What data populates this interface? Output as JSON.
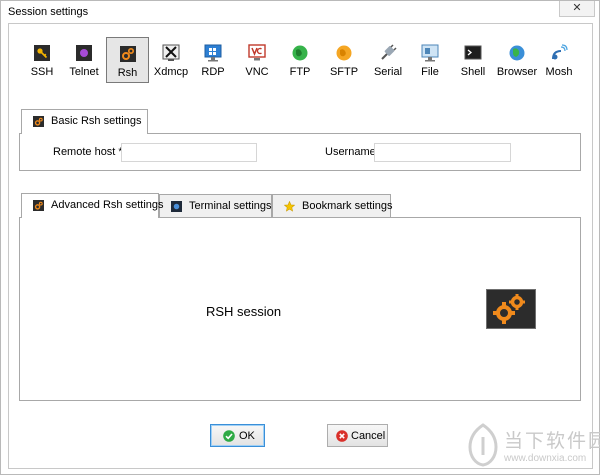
{
  "window": {
    "title": "Session settings",
    "close_glyph": "✕"
  },
  "toolbar": {
    "items": [
      {
        "label": "SSH",
        "icon": "ssh-key-icon",
        "selected": false
      },
      {
        "label": "Telnet",
        "icon": "telnet-icon",
        "selected": false
      },
      {
        "label": "Rsh",
        "icon": "rsh-gears-icon",
        "selected": true
      },
      {
        "label": "Xdmcp",
        "icon": "xdmcp-icon",
        "selected": false
      },
      {
        "label": "RDP",
        "icon": "rdp-monitor-icon",
        "selected": false
      },
      {
        "label": "VNC",
        "icon": "vnc-icon",
        "selected": false
      },
      {
        "label": "FTP",
        "icon": "ftp-globe-icon",
        "selected": false
      },
      {
        "label": "SFTP",
        "icon": "sftp-icon",
        "selected": false
      },
      {
        "label": "Serial",
        "icon": "serial-plug-icon",
        "selected": false
      },
      {
        "label": "File",
        "icon": "file-monitor-icon",
        "selected": false
      },
      {
        "label": "Shell",
        "icon": "shell-terminal-icon",
        "selected": false
      },
      {
        "label": "Browser",
        "icon": "browser-globe-icon",
        "selected": false
      },
      {
        "label": "Mosh",
        "icon": "mosh-satellite-icon",
        "selected": false
      }
    ]
  },
  "basic": {
    "tab_label": "Basic Rsh settings",
    "remote_host_label": "Remote host *",
    "remote_host_value": "",
    "username_label": "Username",
    "username_value": ""
  },
  "lower_tabs": [
    {
      "label": "Advanced Rsh settings",
      "icon": "gears-icon"
    },
    {
      "label": "Terminal settings",
      "icon": "terminal-icon"
    },
    {
      "label": "Bookmark settings",
      "icon": "star-icon"
    }
  ],
  "session_panel": {
    "label": "RSH session",
    "icon": "rsh-session-gears-icon"
  },
  "buttons": {
    "ok_label": "OK",
    "cancel_label": "Cancel"
  },
  "watermark": {
    "text": "当下软件园",
    "url": "www.downxia.com"
  },
  "colors": {
    "accent_orange": "#f08a1c",
    "ok_green": "#2eaa45",
    "cancel_red": "#d9302a",
    "selected_border": "#7a7a7a"
  }
}
